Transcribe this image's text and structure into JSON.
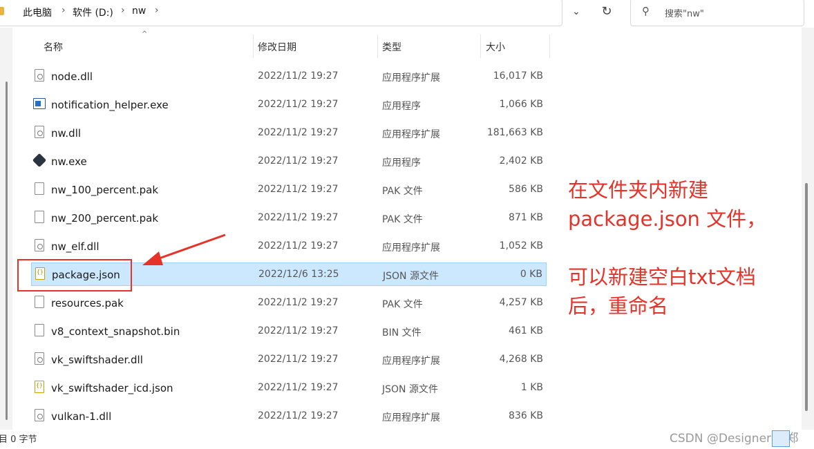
{
  "breadcrumb": {
    "items": [
      "此电脑",
      "软件 (D:)",
      "nw"
    ],
    "separator": "›"
  },
  "search": {
    "placeholder": "搜索\"nw\""
  },
  "columns": {
    "name": "名称",
    "date": "修改日期",
    "type": "类型",
    "size": "大小"
  },
  "files": [
    {
      "name": "node.dll",
      "date": "2022/11/2 19:27",
      "type": "应用程序扩展",
      "size": "16,017 KB",
      "icon": "dll-file-icon"
    },
    {
      "name": "notification_helper.exe",
      "date": "2022/11/2 19:27",
      "type": "应用程序",
      "size": "1,066 KB",
      "icon": "exe-file-icon"
    },
    {
      "name": "nw.dll",
      "date": "2022/11/2 19:27",
      "type": "应用程序扩展",
      "size": "181,663 KB",
      "icon": "dll-file-icon"
    },
    {
      "name": "nw.exe",
      "date": "2022/11/2 19:27",
      "type": "应用程序",
      "size": "2,402 KB",
      "icon": "nw-app-icon"
    },
    {
      "name": "nw_100_percent.pak",
      "date": "2022/11/2 19:27",
      "type": "PAK 文件",
      "size": "586 KB",
      "icon": "generic-file-icon"
    },
    {
      "name": "nw_200_percent.pak",
      "date": "2022/11/2 19:27",
      "type": "PAK 文件",
      "size": "871 KB",
      "icon": "generic-file-icon"
    },
    {
      "name": "nw_elf.dll",
      "date": "2022/11/2 19:27",
      "type": "应用程序扩展",
      "size": "1,052 KB",
      "icon": "dll-file-icon"
    },
    {
      "name": "package.json",
      "date": "2022/12/6 13:25",
      "type": "JSON 源文件",
      "size": "0 KB",
      "icon": "json-file-icon",
      "selected": true
    },
    {
      "name": "resources.pak",
      "date": "2022/11/2 19:27",
      "type": "PAK 文件",
      "size": "4,257 KB",
      "icon": "generic-file-icon"
    },
    {
      "name": "v8_context_snapshot.bin",
      "date": "2022/11/2 19:27",
      "type": "BIN 文件",
      "size": "461 KB",
      "icon": "generic-file-icon"
    },
    {
      "name": "vk_swiftshader.dll",
      "date": "2022/11/2 19:27",
      "type": "应用程序扩展",
      "size": "4,268 KB",
      "icon": "dll-file-icon"
    },
    {
      "name": "vk_swiftshader_icd.json",
      "date": "2022/11/2 19:27",
      "type": "JSON 源文件",
      "size": "1 KB",
      "icon": "json-file-icon"
    },
    {
      "name": "vulkan-1.dll",
      "date": "2022/11/2 19:27",
      "type": "应用程序扩展",
      "size": "836 KB",
      "icon": "dll-file-icon"
    }
  ],
  "annotation": {
    "lines": [
      "在文件夹内新建",
      "package.json 文件，",
      "",
      "可以新建空白txt文档",
      "后，重命名"
    ],
    "color": "#e5332a"
  },
  "status": {
    "text": "目 0 字节"
  },
  "watermark": "CSDN @Designer 小郑"
}
